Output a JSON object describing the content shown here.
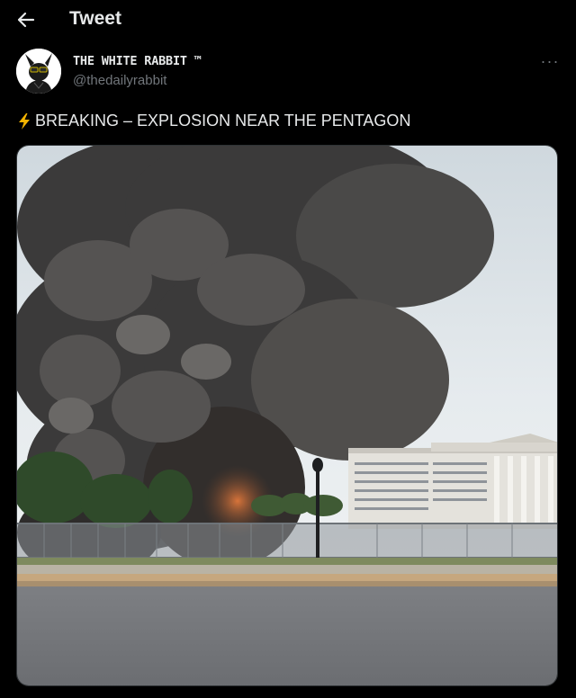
{
  "header": {
    "title": "Tweet",
    "back_icon": "arrow-left-icon"
  },
  "author": {
    "display_name": "THE WHITE RABBIT ™",
    "handle": "@thedailyrabbit",
    "avatar_icon": "rabbit-avatar"
  },
  "tweet": {
    "text": "BREAKING – EXPLOSION NEAR THE PENTAGON",
    "emoji_icon": "lightning-bolt-icon",
    "more_icon": "more-dots-icon"
  },
  "media": {
    "kind": "photo",
    "subject": "smoke plume beside large building"
  },
  "colors": {
    "background": "#000000",
    "text_primary": "#e7e9ea",
    "text_secondary": "#71767b",
    "bolt": "#f4b400"
  }
}
